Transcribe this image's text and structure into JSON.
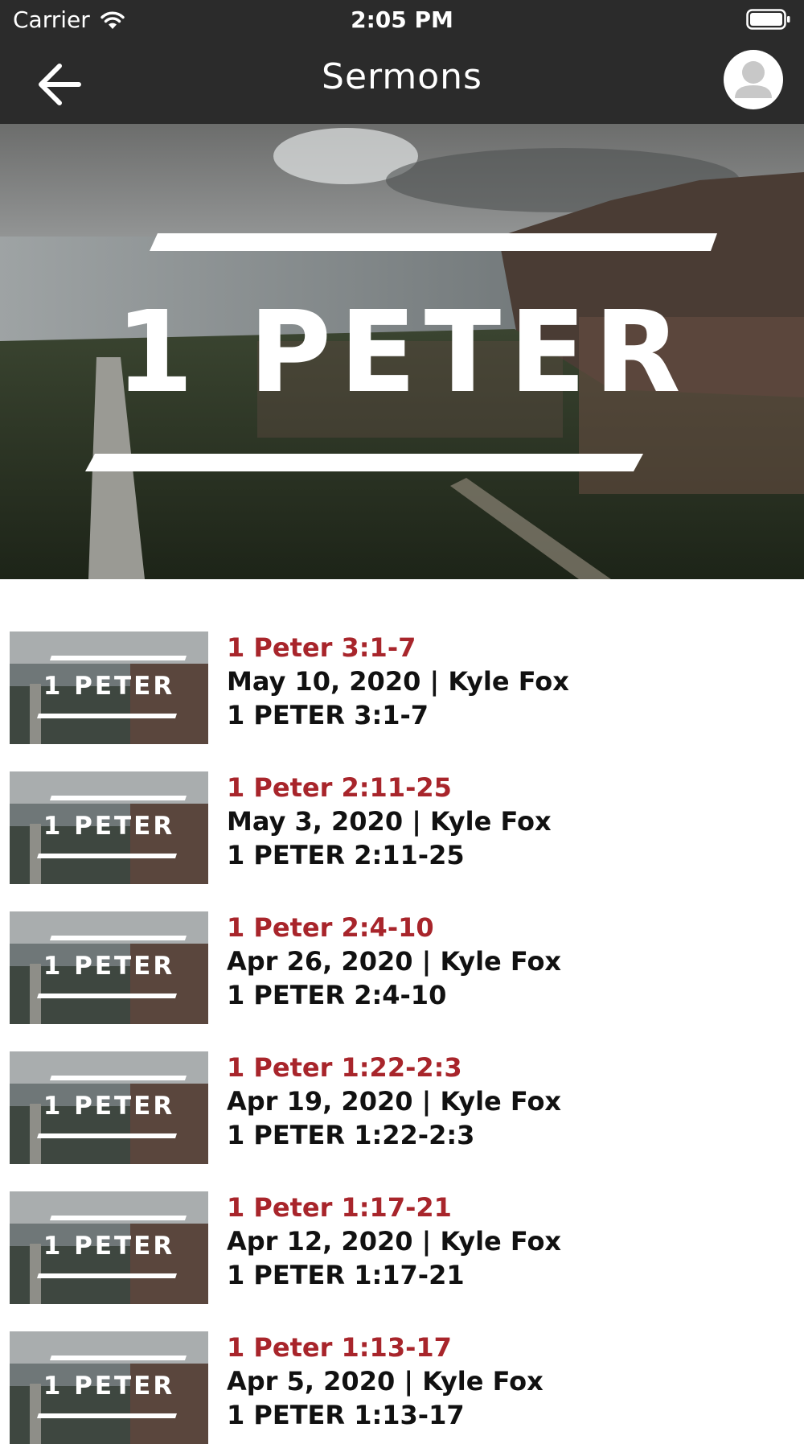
{
  "status_bar": {
    "carrier": "Carrier",
    "time": "2:05 PM"
  },
  "nav": {
    "title": "Sermons"
  },
  "hero": {
    "title": "1 PETER"
  },
  "sermons": [
    {
      "title": "1 Peter 3:1-7",
      "meta": "May 10, 2020 | Kyle Fox",
      "subtitle": "1 PETER 3:1-7",
      "thumb_label": "1 PETER"
    },
    {
      "title": "1 Peter 2:11-25",
      "meta": "May 3, 2020 | Kyle Fox",
      "subtitle": "1 PETER 2:11-25",
      "thumb_label": "1 PETER"
    },
    {
      "title": "1 Peter 2:4-10",
      "meta": "Apr 26, 2020 | Kyle Fox",
      "subtitle": "1 PETER 2:4-10",
      "thumb_label": "1 PETER"
    },
    {
      "title": "1 Peter 1:22-2:3",
      "meta": "Apr 19, 2020 | Kyle Fox",
      "subtitle": "1 PETER 1:22-2:3",
      "thumb_label": "1 PETER"
    },
    {
      "title": "1 Peter 1:17-21",
      "meta": "Apr 12, 2020 | Kyle Fox",
      "subtitle": "1 PETER 1:17-21",
      "thumb_label": "1 PETER"
    },
    {
      "title": "1 Peter 1:13-17",
      "meta": "Apr 5, 2020 | Kyle Fox",
      "subtitle": "1 PETER 1:13-17",
      "thumb_label": "1 PETER"
    }
  ],
  "colors": {
    "nav_bg": "#2b2b2b",
    "accent": "#a8252b"
  },
  "icons": {
    "back": "back-arrow-icon",
    "profile": "user-avatar-icon",
    "wifi": "wifi-icon",
    "battery": "battery-icon"
  }
}
